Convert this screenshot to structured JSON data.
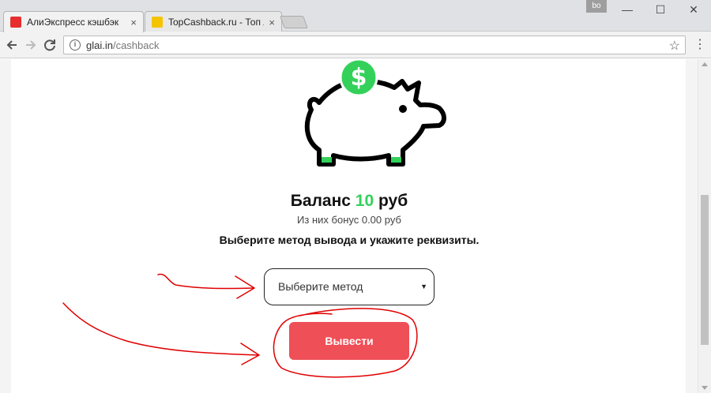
{
  "browser": {
    "tabs": [
      {
        "title": "АлиЭкспресс кэшбэк",
        "close": "×",
        "favicon_color": "#e62e2e",
        "active": true
      },
      {
        "title": "TopCashback.ru - Топ лу",
        "close": "×",
        "favicon_color": "#f5c400",
        "active": false
      }
    ],
    "profile_label": "bo",
    "window_controls": {
      "minimize": "—",
      "maximize": "☐",
      "close": "✕"
    },
    "address": {
      "host": "glai.in",
      "path": "/cashback"
    },
    "icons": {
      "back": "back-arrow-icon",
      "forward": "forward-arrow-icon",
      "reload": "reload-icon",
      "info": "info-icon",
      "bookmark": "star-icon",
      "menu": "menu-dots-icon"
    }
  },
  "page": {
    "balance_label": "Баланс",
    "balance_amount": "10",
    "balance_currency": "руб",
    "bonus_text": "Из них бонус 0.00 руб",
    "instruction": "Выберите метод вывода и укажите реквизиты.",
    "method_select": {
      "placeholder": "Выберите метод",
      "caret": "▼"
    },
    "withdraw_button": "Вывести",
    "colors": {
      "accent_green": "#33d15a",
      "button_red": "#ef4f57",
      "annotation_red": "#e00000"
    }
  }
}
